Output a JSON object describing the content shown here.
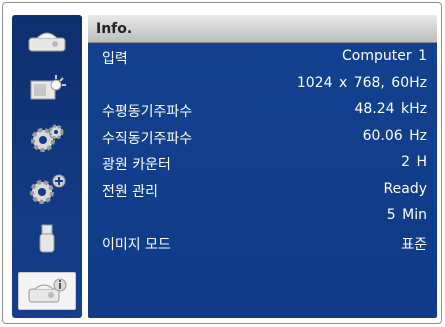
{
  "header": {
    "title": "Info."
  },
  "sidebar": {
    "items": [
      {
        "icon": "display-icon",
        "active": false
      },
      {
        "icon": "image-adjust-icon",
        "active": false
      },
      {
        "icon": "setting-gear-icon",
        "active": false
      },
      {
        "icon": "expanded-setting-icon",
        "active": false
      },
      {
        "icon": "usb-icon",
        "active": false
      },
      {
        "icon": "info-icon",
        "active": true
      }
    ]
  },
  "info": {
    "input_label": "입력",
    "input_value": "Computer 1",
    "resolution_value": "1024 x 768, 60Hz",
    "h_sync_label": "수평동기주파수",
    "h_sync_value": "48.24  kHz",
    "v_sync_label": "수직동기주파수",
    "v_sync_value": "60.06   Hz",
    "lamp_label": "광원 카운터",
    "lamp_value": "2     H",
    "power_label": "전원 관리",
    "power_state_value": "Ready",
    "power_time_value": "5   Min",
    "image_mode_label": "이미지 모드",
    "image_mode_value": "표준"
  },
  "colors": {
    "panel_blue": "#13408c",
    "sidebar_blue": "#133a82",
    "header_gray": "#d4d4d4",
    "text": "#ffffff"
  }
}
